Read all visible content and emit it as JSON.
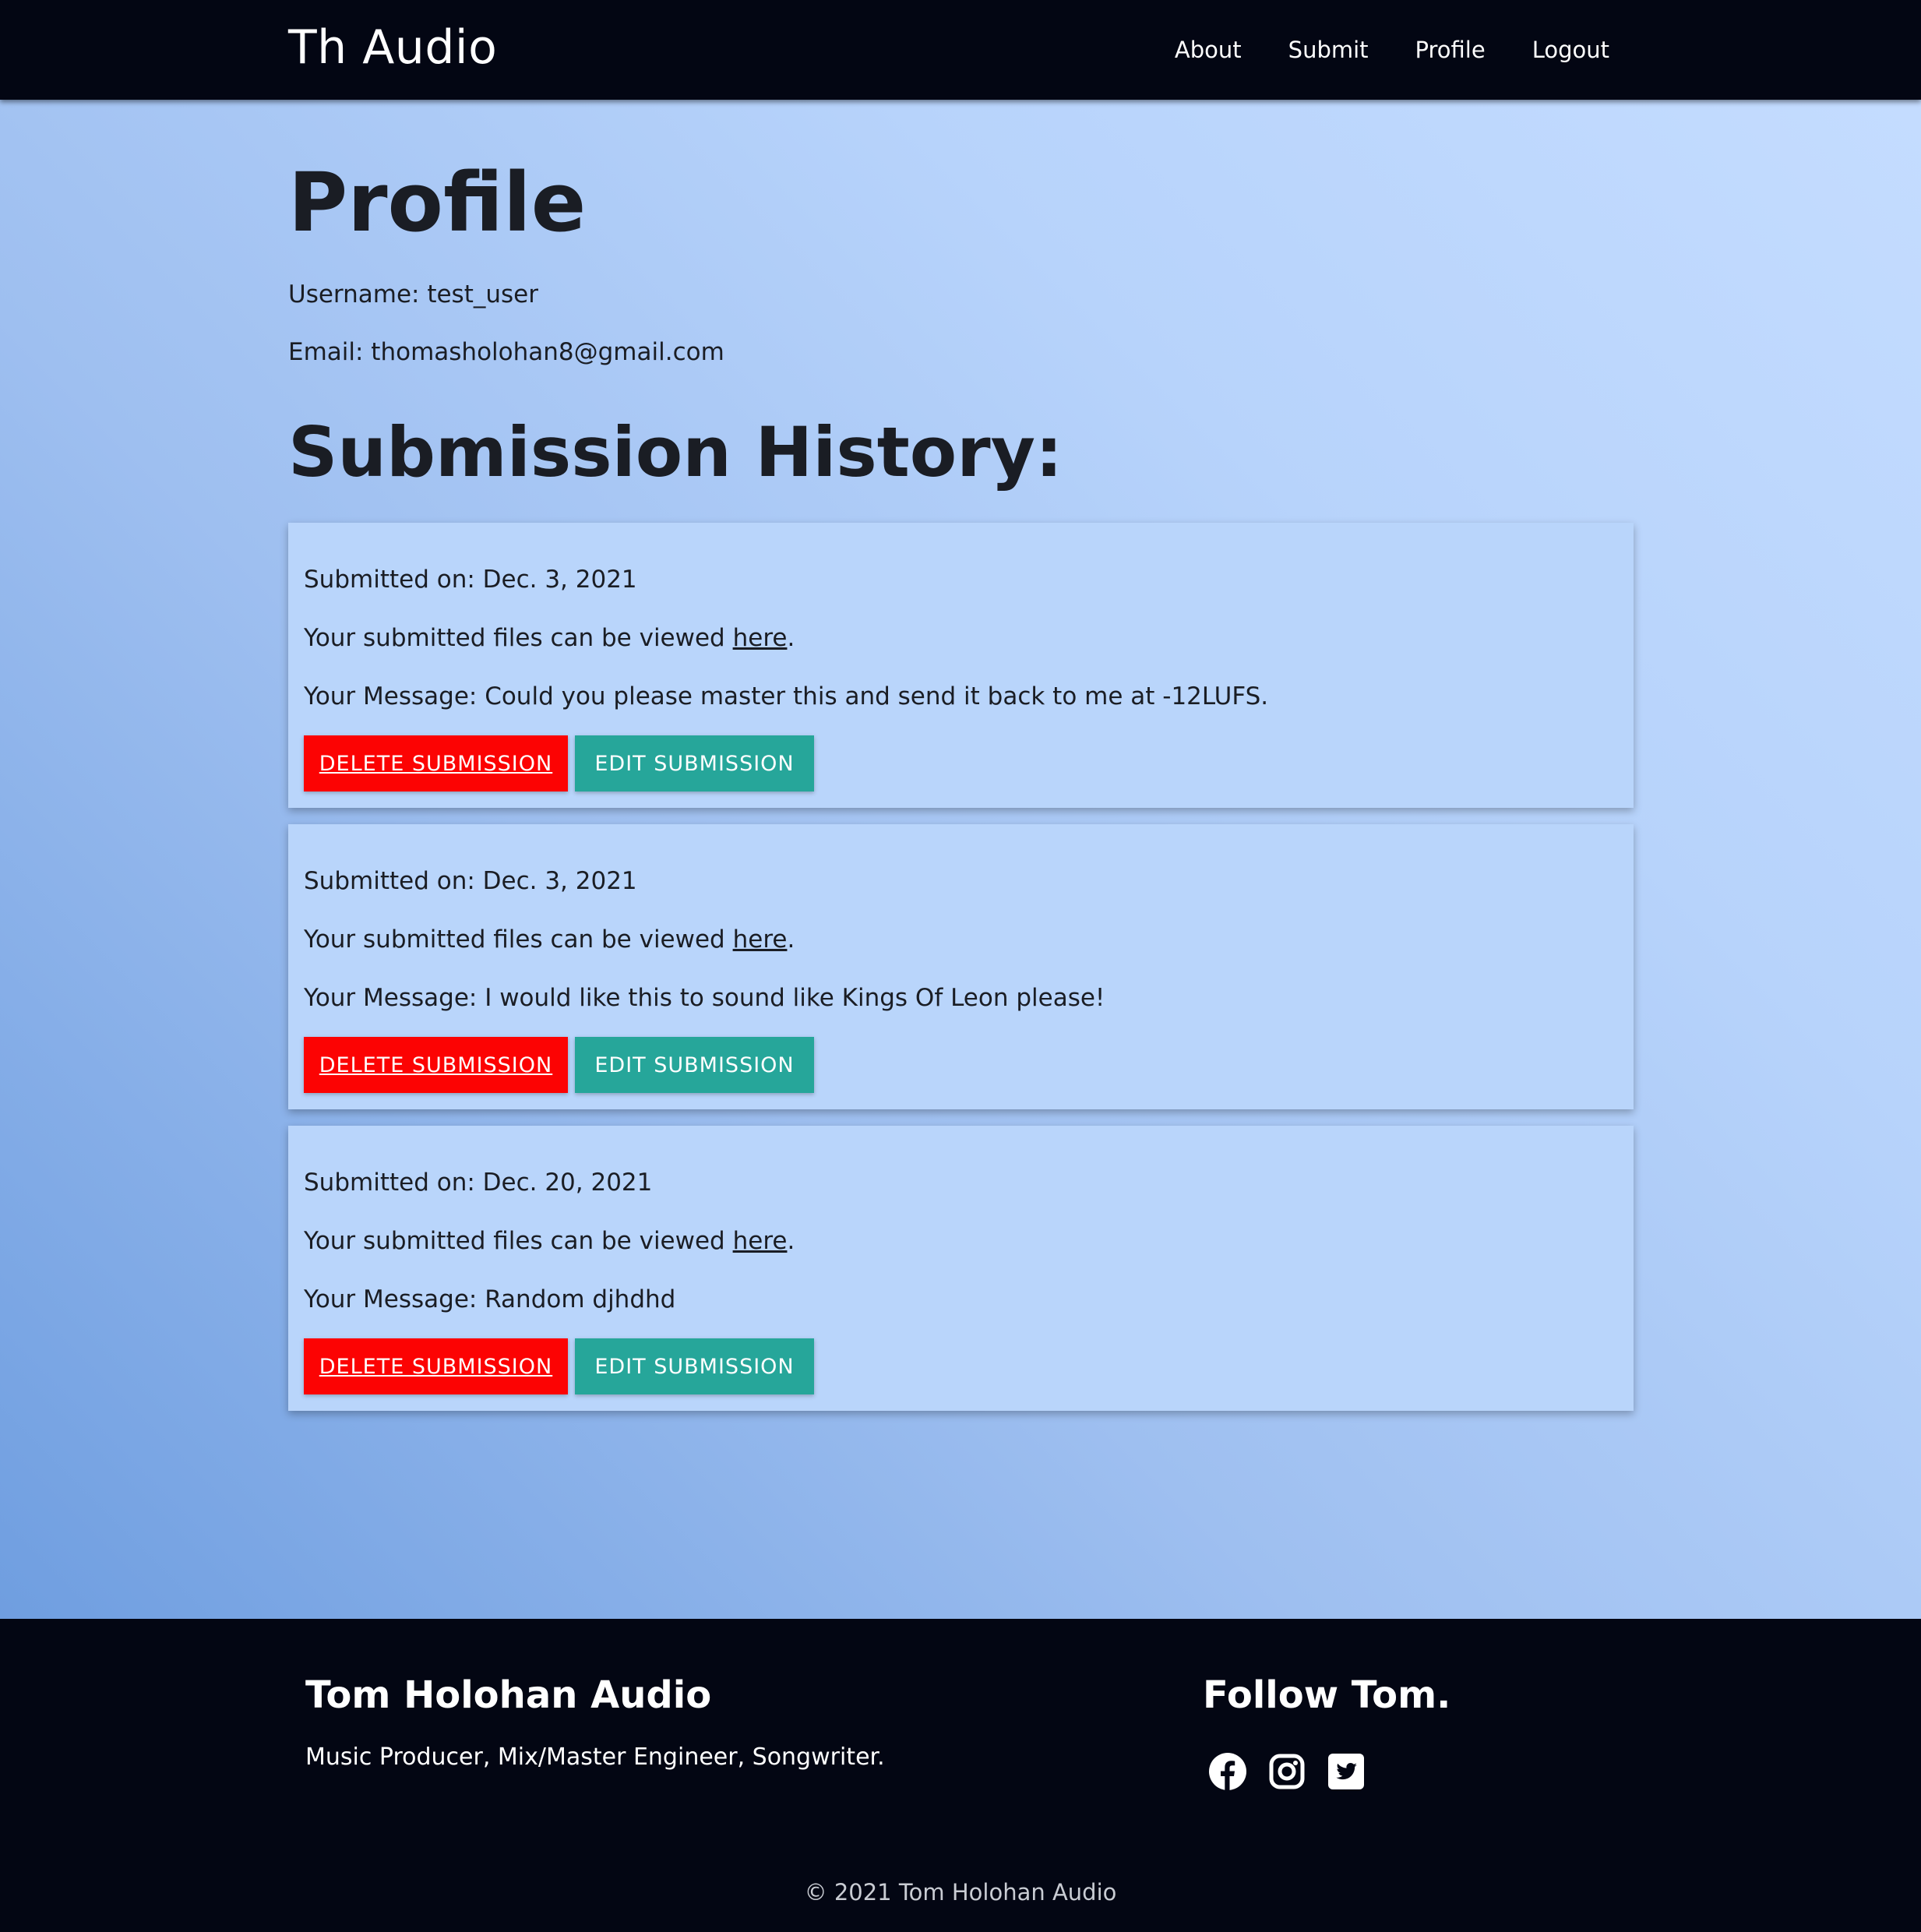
{
  "navbar": {
    "brand": "Th Audio",
    "links": [
      "About",
      "Submit",
      "Profile",
      "Logout"
    ]
  },
  "profile": {
    "title": "Profile",
    "username_line": "Username: test_user",
    "email_line": "Email: thomasholohan8@gmail.com"
  },
  "history": {
    "title": "Submission History:",
    "view_prefix": "Your submitted files can be viewed ",
    "view_link": "here",
    "view_suffix": ".",
    "delete_label": "DELETE SUBMISSION",
    "edit_label": "EDIT SUBMISSION",
    "submissions": [
      {
        "date": "Submitted on: Dec. 3, 2021",
        "message": "Your Message: Could you please master this and send it back to me at -12LUFS."
      },
      {
        "date": "Submitted on: Dec. 3, 2021",
        "message": "Your Message: I would like this to sound like Kings Of Leon please!"
      },
      {
        "date": "Submitted on: Dec. 20, 2021",
        "message": "Your Message: Random djhdhd"
      }
    ]
  },
  "footer": {
    "title": "Tom Holohan Audio",
    "tagline": "Music Producer, Mix/Master Engineer, Songwriter.",
    "follow_title": "Follow Tom.",
    "social_icons": [
      "facebook-icon",
      "instagram-icon",
      "twitter-icon"
    ],
    "copyright": "© 2021 Tom Holohan Audio"
  },
  "colors": {
    "navbar_bg": "#030613",
    "card_bg": "#b9d5fb",
    "delete_button": "#fc0303",
    "edit_button": "#26a69a",
    "text_dark": "#1a1d24"
  }
}
